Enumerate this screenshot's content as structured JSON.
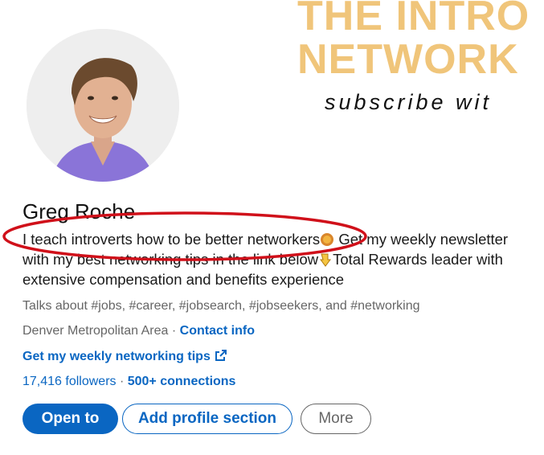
{
  "banner": {
    "line1": "THE INTRO",
    "line2": "NETWORK",
    "subtitle": "subscribe wit",
    "color": "#f0c57a"
  },
  "profile": {
    "name": "Greg Roche",
    "headline_part1": "I teach introverts how to be better networkers",
    "headline_part2": " Get my weekly newsletter with my best networking tips in the link below",
    "headline_part3": "Total Rewards leader with extensive compensation and benefits experience",
    "talks_about": "Talks about #jobs, #career, #jobsearch, #jobseekers, and #networking",
    "location": "Denver Metropolitan Area",
    "separator": " · ",
    "contact_info": "Contact info",
    "website_link": "Get my weekly networking tips",
    "followers": "17,416 followers",
    "stats_separator": " · ",
    "connections": "500+ connections"
  },
  "actions": {
    "open_to": "Open to",
    "add_section": "Add profile section",
    "more": "More"
  },
  "colors": {
    "accent": "#0a66c2",
    "annotation": "#d0101a"
  },
  "icons": {
    "emoji_1": "thumbs-up-emoji-icon",
    "emoji_2": "point-down-emoji-icon",
    "external_link": "external-link-icon"
  }
}
